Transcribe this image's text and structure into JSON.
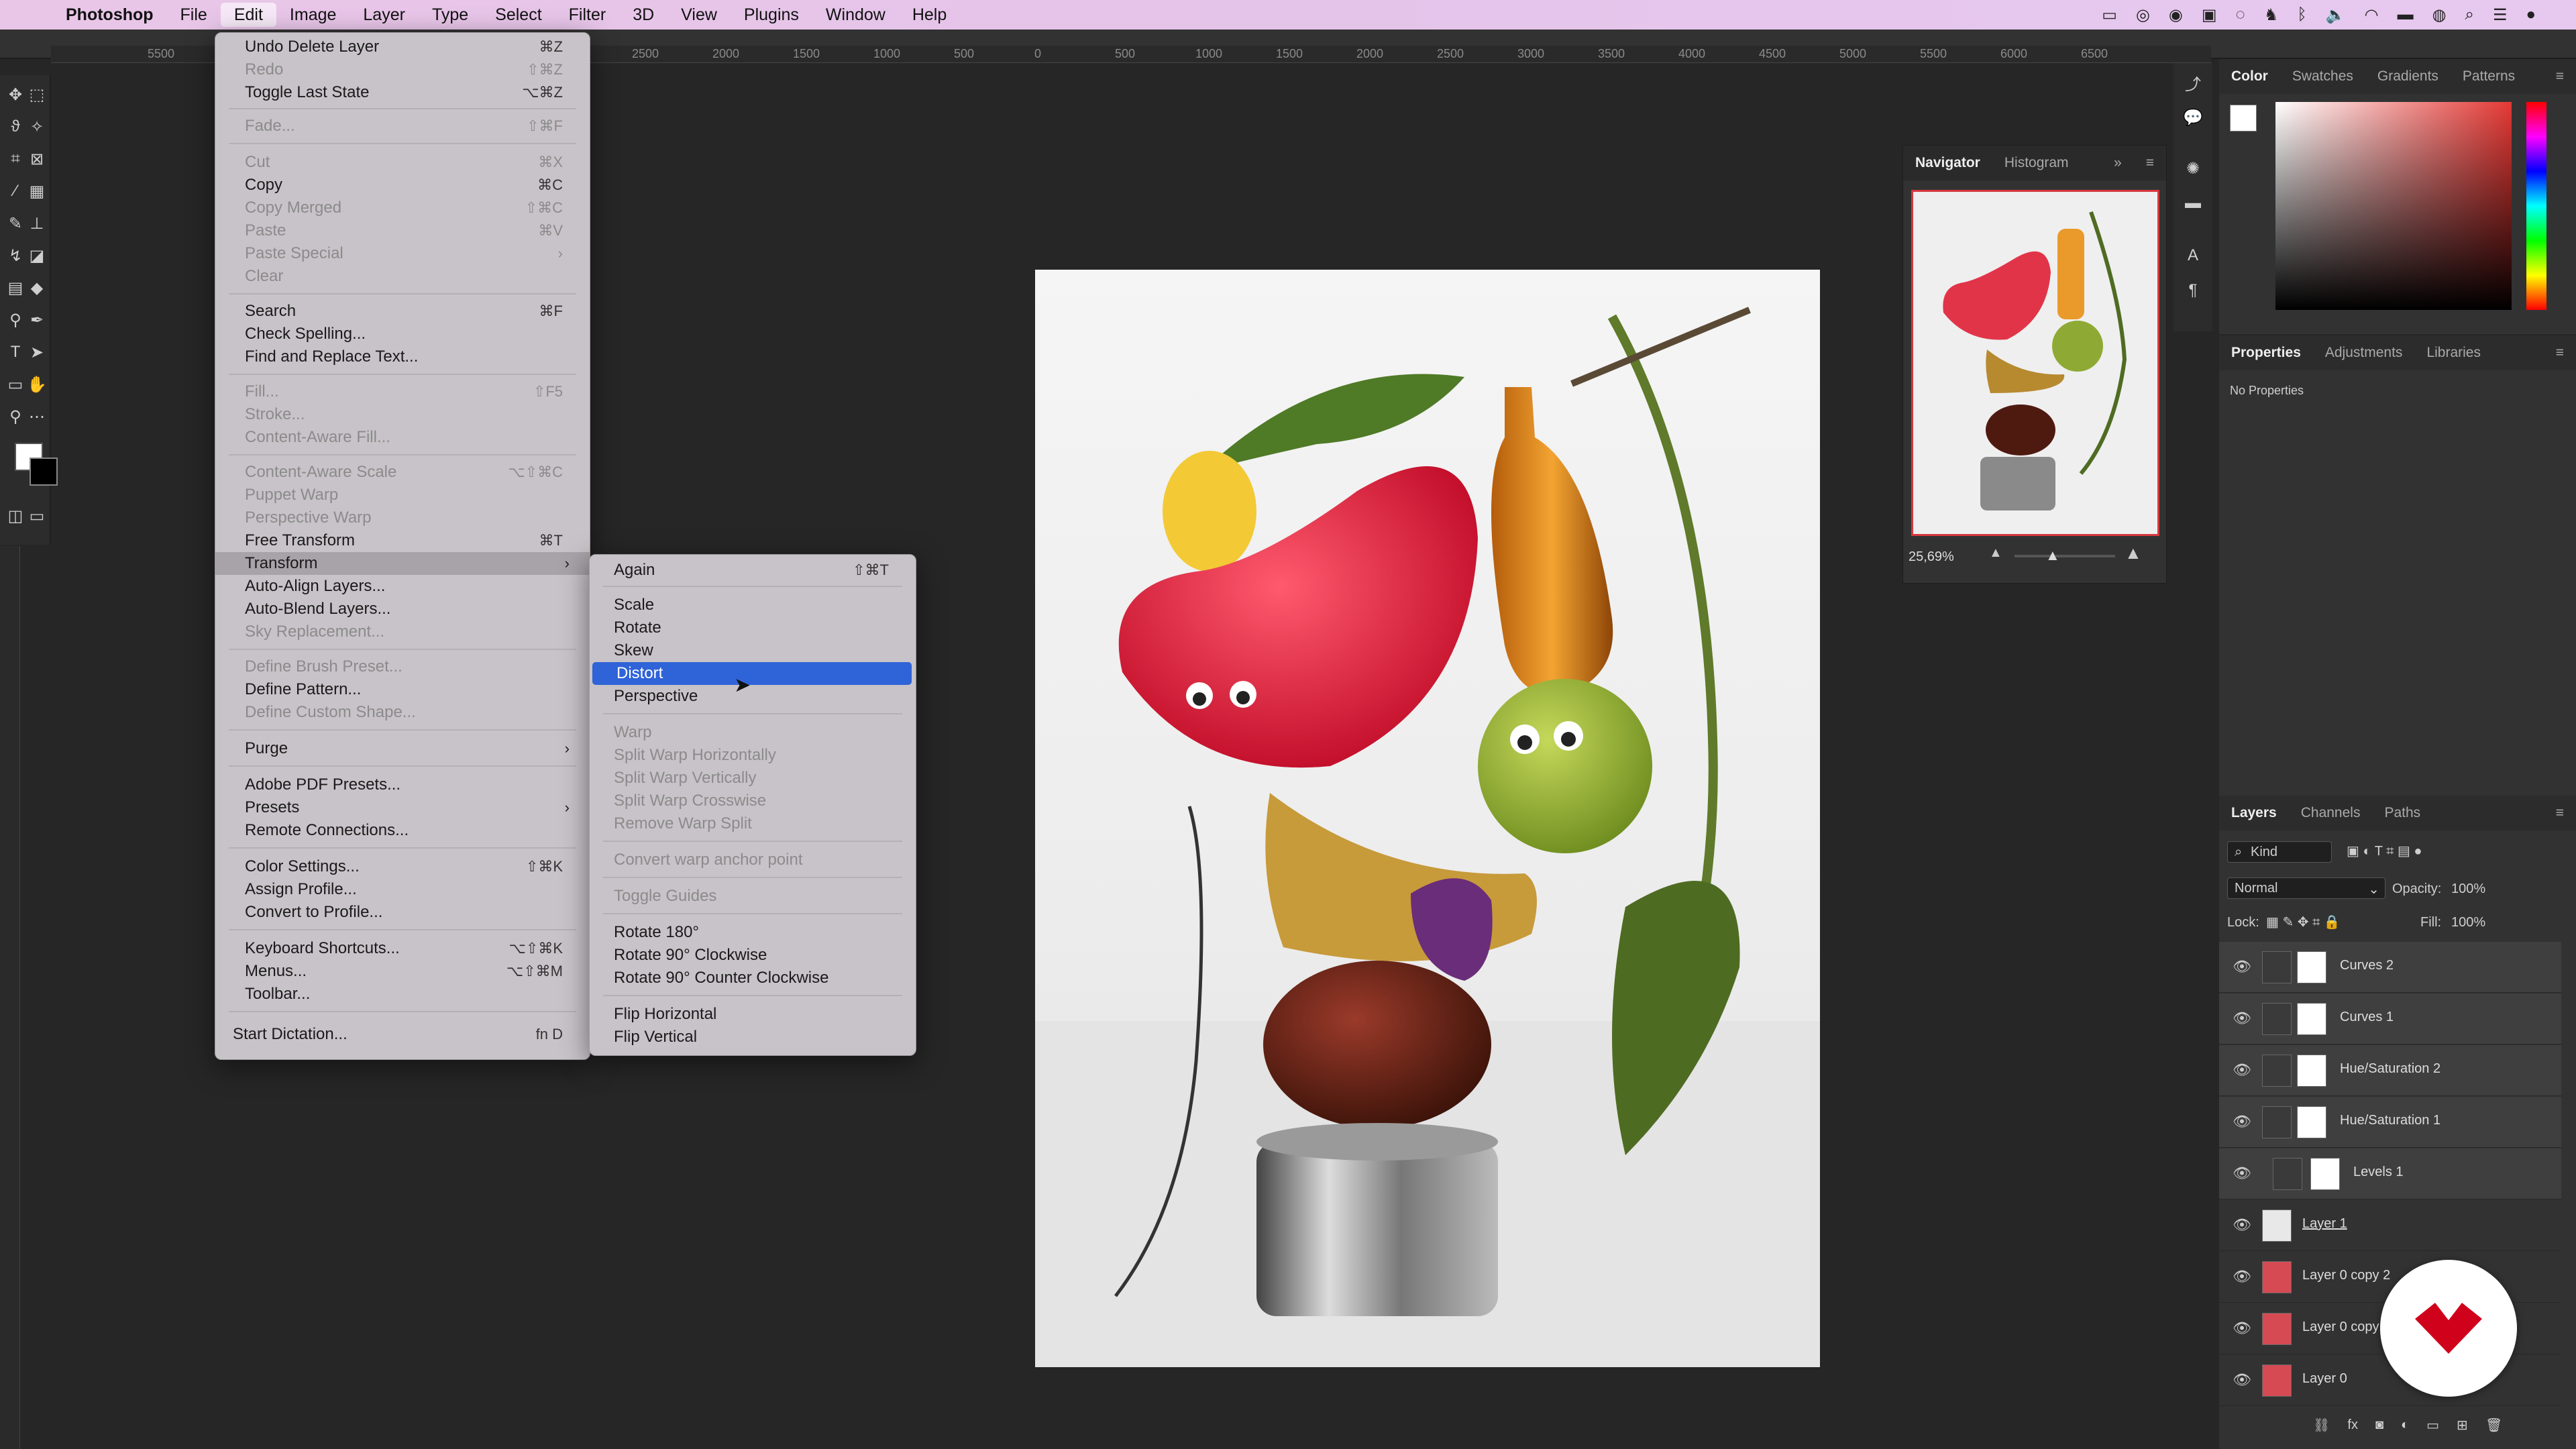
{
  "menubar": {
    "app": "Photoshop",
    "items": [
      "File",
      "Edit",
      "Image",
      "Layer",
      "Type",
      "Select",
      "Filter",
      "3D",
      "View",
      "Plugins",
      "Window",
      "Help"
    ]
  },
  "ruler_top": [
    "5500",
    "2500",
    "2000",
    "1500",
    "1000",
    "500",
    "0",
    "500",
    "1000",
    "1500",
    "2000",
    "2500",
    "3000",
    "3500",
    "4000",
    "4500",
    "5000",
    "5500",
    "6000",
    "6500"
  ],
  "edit_menu": [
    {
      "label": "Undo Delete Layer",
      "sc": "⌘Z",
      "disabled": false
    },
    {
      "label": "Redo",
      "sc": "⇧⌘Z",
      "disabled": true
    },
    {
      "label": "Toggle Last State",
      "sc": "⌥⌘Z",
      "disabled": false
    },
    {
      "label": "Fade...",
      "sc": "⇧⌘F",
      "disabled": true
    },
    {
      "label": "Cut",
      "sc": "⌘X",
      "disabled": true
    },
    {
      "label": "Copy",
      "sc": "⌘C",
      "disabled": false
    },
    {
      "label": "Copy Merged",
      "sc": "⇧⌘C",
      "disabled": true
    },
    {
      "label": "Paste",
      "sc": "⌘V",
      "disabled": true
    },
    {
      "label": "Paste Special",
      "sc": "›",
      "disabled": true
    },
    {
      "label": "Clear",
      "sc": "",
      "disabled": true
    },
    {
      "label": "Search",
      "sc": "⌘F",
      "disabled": false
    },
    {
      "label": "Check Spelling...",
      "sc": "",
      "disabled": false
    },
    {
      "label": "Find and Replace Text...",
      "sc": "",
      "disabled": false
    },
    {
      "label": "Fill...",
      "sc": "⇧F5",
      "disabled": true
    },
    {
      "label": "Stroke...",
      "sc": "",
      "disabled": true
    },
    {
      "label": "Content-Aware Fill...",
      "sc": "",
      "disabled": true
    },
    {
      "label": "Content-Aware Scale",
      "sc": "⌥⇧⌘C",
      "disabled": true
    },
    {
      "label": "Puppet Warp",
      "sc": "",
      "disabled": true
    },
    {
      "label": "Perspective Warp",
      "sc": "",
      "disabled": true
    },
    {
      "label": "Free Transform",
      "sc": "⌘T",
      "disabled": false
    },
    {
      "label": "Transform",
      "sc": "›",
      "disabled": false
    },
    {
      "label": "Auto-Align Layers...",
      "sc": "",
      "disabled": false
    },
    {
      "label": "Auto-Blend Layers...",
      "sc": "",
      "disabled": false
    },
    {
      "label": "Sky Replacement...",
      "sc": "",
      "disabled": true
    },
    {
      "label": "Define Brush Preset...",
      "sc": "",
      "disabled": true
    },
    {
      "label": "Define Pattern...",
      "sc": "",
      "disabled": false
    },
    {
      "label": "Define Custom Shape...",
      "sc": "",
      "disabled": true
    },
    {
      "label": "Purge",
      "sc": "›",
      "disabled": false
    },
    {
      "label": "Adobe PDF Presets...",
      "sc": "",
      "disabled": false
    },
    {
      "label": "Presets",
      "sc": "›",
      "disabled": false
    },
    {
      "label": "Remote Connections...",
      "sc": "",
      "disabled": false
    },
    {
      "label": "Color Settings...",
      "sc": "⇧⌘K",
      "disabled": false
    },
    {
      "label": "Assign Profile...",
      "sc": "",
      "disabled": false
    },
    {
      "label": "Convert to Profile...",
      "sc": "",
      "disabled": false
    },
    {
      "label": "Keyboard Shortcuts...",
      "sc": "⌥⇧⌘K",
      "disabled": false
    },
    {
      "label": "Menus...",
      "sc": "⌥⇧⌘M",
      "disabled": false
    },
    {
      "label": "Toolbar...",
      "sc": "",
      "disabled": false
    },
    {
      "label": "Start Dictation...",
      "sc": "fn D",
      "disabled": false
    }
  ],
  "transform_menu": [
    {
      "label": "Again",
      "sc": "⇧⌘T",
      "disabled": false
    },
    {
      "label": "Scale",
      "sc": "",
      "disabled": false
    },
    {
      "label": "Rotate",
      "sc": "",
      "disabled": false
    },
    {
      "label": "Skew",
      "sc": "",
      "disabled": false
    },
    {
      "label": "Distort",
      "sc": "",
      "disabled": false
    },
    {
      "label": "Perspective",
      "sc": "",
      "disabled": false
    },
    {
      "label": "Warp",
      "sc": "",
      "disabled": true
    },
    {
      "label": "Split Warp Horizontally",
      "sc": "",
      "disabled": true
    },
    {
      "label": "Split Warp Vertically",
      "sc": "",
      "disabled": true
    },
    {
      "label": "Split Warp Crosswise",
      "sc": "",
      "disabled": true
    },
    {
      "label": "Remove Warp Split",
      "sc": "",
      "disabled": true
    },
    {
      "label": "Convert warp anchor point",
      "sc": "",
      "disabled": true
    },
    {
      "label": "Toggle Guides",
      "sc": "",
      "disabled": true
    },
    {
      "label": "Rotate 180°",
      "sc": "",
      "disabled": false
    },
    {
      "label": "Rotate 90° Clockwise",
      "sc": "",
      "disabled": false
    },
    {
      "label": "Rotate 90° Counter Clockwise",
      "sc": "",
      "disabled": false
    },
    {
      "label": "Flip Horizontal",
      "sc": "",
      "disabled": false
    },
    {
      "label": "Flip Vertical",
      "sc": "",
      "disabled": false
    }
  ],
  "navigator": {
    "tabs": [
      "Navigator",
      "Histogram"
    ],
    "zoom": "25,69%"
  },
  "color_panel": {
    "tabs": [
      "Color",
      "Swatches",
      "Gradients",
      "Patterns"
    ]
  },
  "properties_panel": {
    "tabs": [
      "Properties",
      "Adjustments",
      "Libraries"
    ],
    "empty_text": "No Properties"
  },
  "layers_panel": {
    "tabs": [
      "Layers",
      "Channels",
      "Paths"
    ],
    "filter": "Kind",
    "blend_mode": "Normal",
    "opacity_label": "Opacity:",
    "opacity": "100%",
    "lock_label": "Lock:",
    "fill_label": "Fill:",
    "fill": "100%",
    "layers": [
      "Curves 2",
      "Curves 1",
      "Hue/Saturation 2",
      "Hue/Saturation 1",
      "Levels 1",
      "Layer 1",
      "Layer 0 copy 2",
      "Layer 0 copy",
      "Layer 0"
    ]
  },
  "colors": {
    "selection": "#2f63d8",
    "brand_logo": "#d0021b"
  }
}
